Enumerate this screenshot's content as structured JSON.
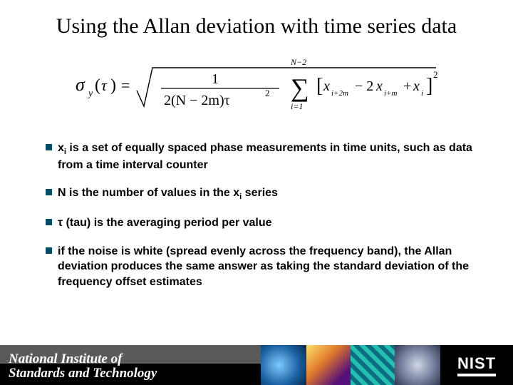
{
  "title": "Using the Allan deviation with time series data",
  "formula": {
    "lhs_symbol": "σ",
    "lhs_subscript": "y",
    "lhs_arg": "τ",
    "rhs_denominator": "2(N − 2m)τ",
    "rhs_denominator_power": "2",
    "sum_lower": "i=1",
    "sum_upper": "N−2",
    "term_a": "x",
    "term_a_sub": "i+2m",
    "term_b_coef": "− 2",
    "term_b": "x",
    "term_b_sub": "i+m",
    "term_c_coef": "+ ",
    "term_c": "x",
    "term_c_sub": "i",
    "outer_power": "2"
  },
  "bullets": [
    {
      "pre": "x",
      "sub": "i",
      "post": " is a set of equally spaced phase measurements in time units, such as data from a time interval counter"
    },
    {
      "text1": "N is the number of values in the x",
      "sub": "i",
      "text2": " series"
    },
    {
      "text": "τ (tau) is the averaging period per value"
    },
    {
      "text": "if the noise is white (spread evenly across the frequency band), the Allan deviation produces the same answer as taking the standard deviation of the frequency offset estimates"
    }
  ],
  "footer": {
    "org_line1": "National Institute of",
    "org_line2": "Standards and Technology",
    "logo": "NIST"
  }
}
